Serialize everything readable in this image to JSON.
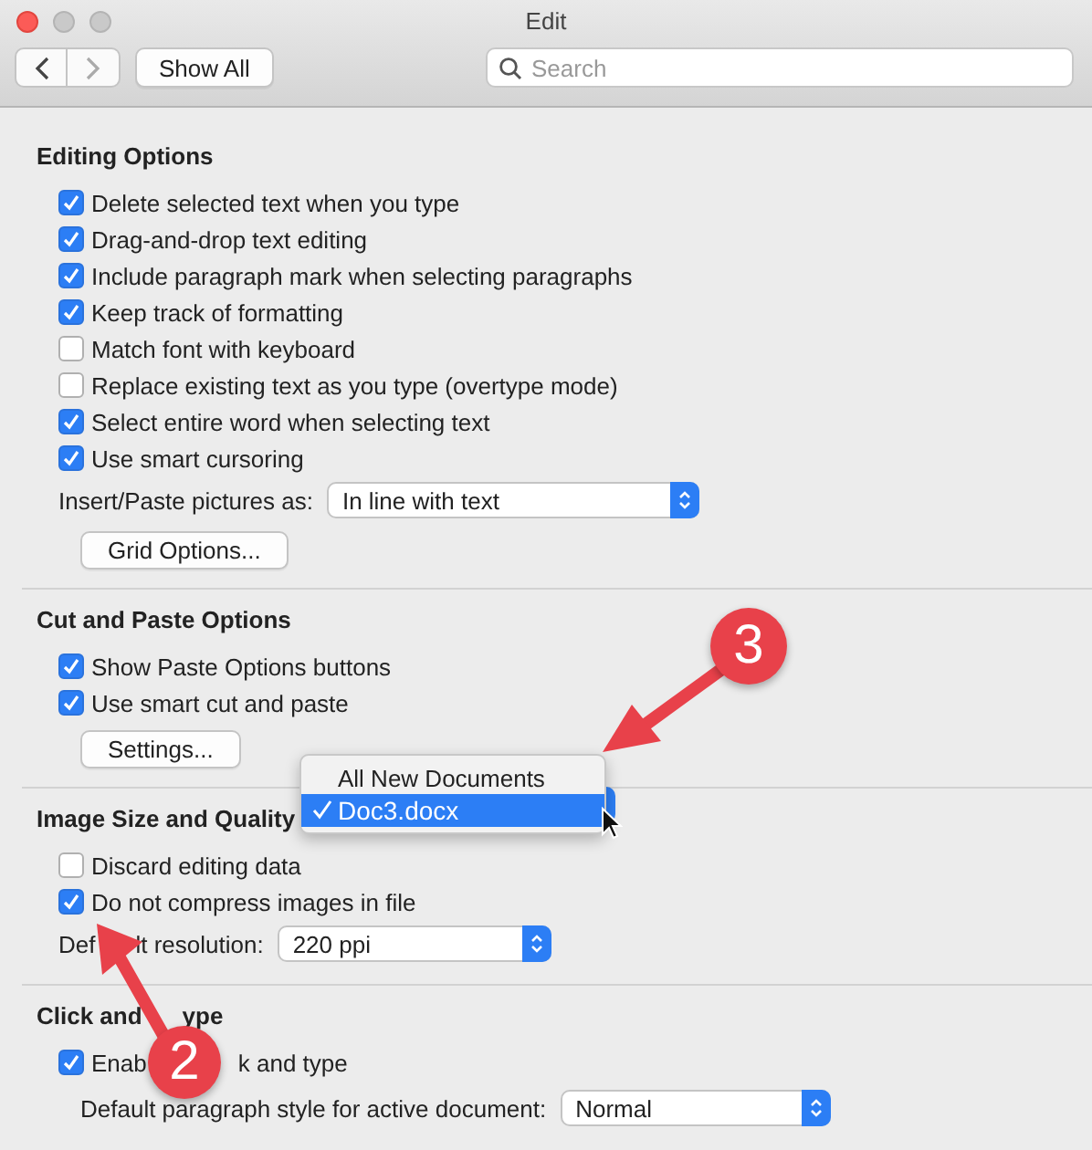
{
  "window": {
    "title": "Edit"
  },
  "toolbar": {
    "show_all": "Show All",
    "search": {
      "placeholder": "Search"
    }
  },
  "sections": [
    {
      "heading": "Editing Options",
      "options": [
        {
          "label": "Delete selected text when you type",
          "checked": true
        },
        {
          "label": "Drag-and-drop text editing",
          "checked": true
        },
        {
          "label": "Include paragraph mark when selecting paragraphs",
          "checked": true
        },
        {
          "label": "Keep track of formatting",
          "checked": true
        },
        {
          "label": "Match font with keyboard",
          "checked": false
        },
        {
          "label": "Replace existing text as you type (overtype mode)",
          "checked": false
        },
        {
          "label": "Select entire word when selecting text",
          "checked": true
        },
        {
          "label": "Use smart cursoring",
          "checked": true
        }
      ],
      "popup": {
        "label": "Insert/Paste pictures as:",
        "value": "In line with text"
      },
      "button": "Grid Options..."
    },
    {
      "heading": "Cut and Paste Options",
      "options": [
        {
          "label": "Show Paste Options buttons",
          "checked": true
        },
        {
          "label": "Use smart cut and paste",
          "checked": true
        }
      ],
      "button": "Settings..."
    },
    {
      "heading": "Image Size and Quality",
      "options": [
        {
          "label": "Discard editing data",
          "checked": false
        },
        {
          "label": "Do not compress images in file",
          "checked": true
        }
      ],
      "popup": {
        "label": [
          "Def",
          "lt resolution:"
        ],
        "value": "220 ppi"
      }
    },
    {
      "heading": [
        "Click and",
        "ype"
      ],
      "options": [
        {
          "label": [
            "Enab",
            "k and type"
          ],
          "checked": true
        }
      ],
      "popup": {
        "label": "Default paragraph style for active document:",
        "value": "Normal"
      }
    }
  ],
  "open_menu": {
    "items": [
      {
        "label": "All New Documents",
        "selected": false
      },
      {
        "label": "Doc3.docx",
        "selected": true
      }
    ]
  },
  "callouts": [
    {
      "number": "3"
    },
    {
      "number": "2"
    }
  ]
}
